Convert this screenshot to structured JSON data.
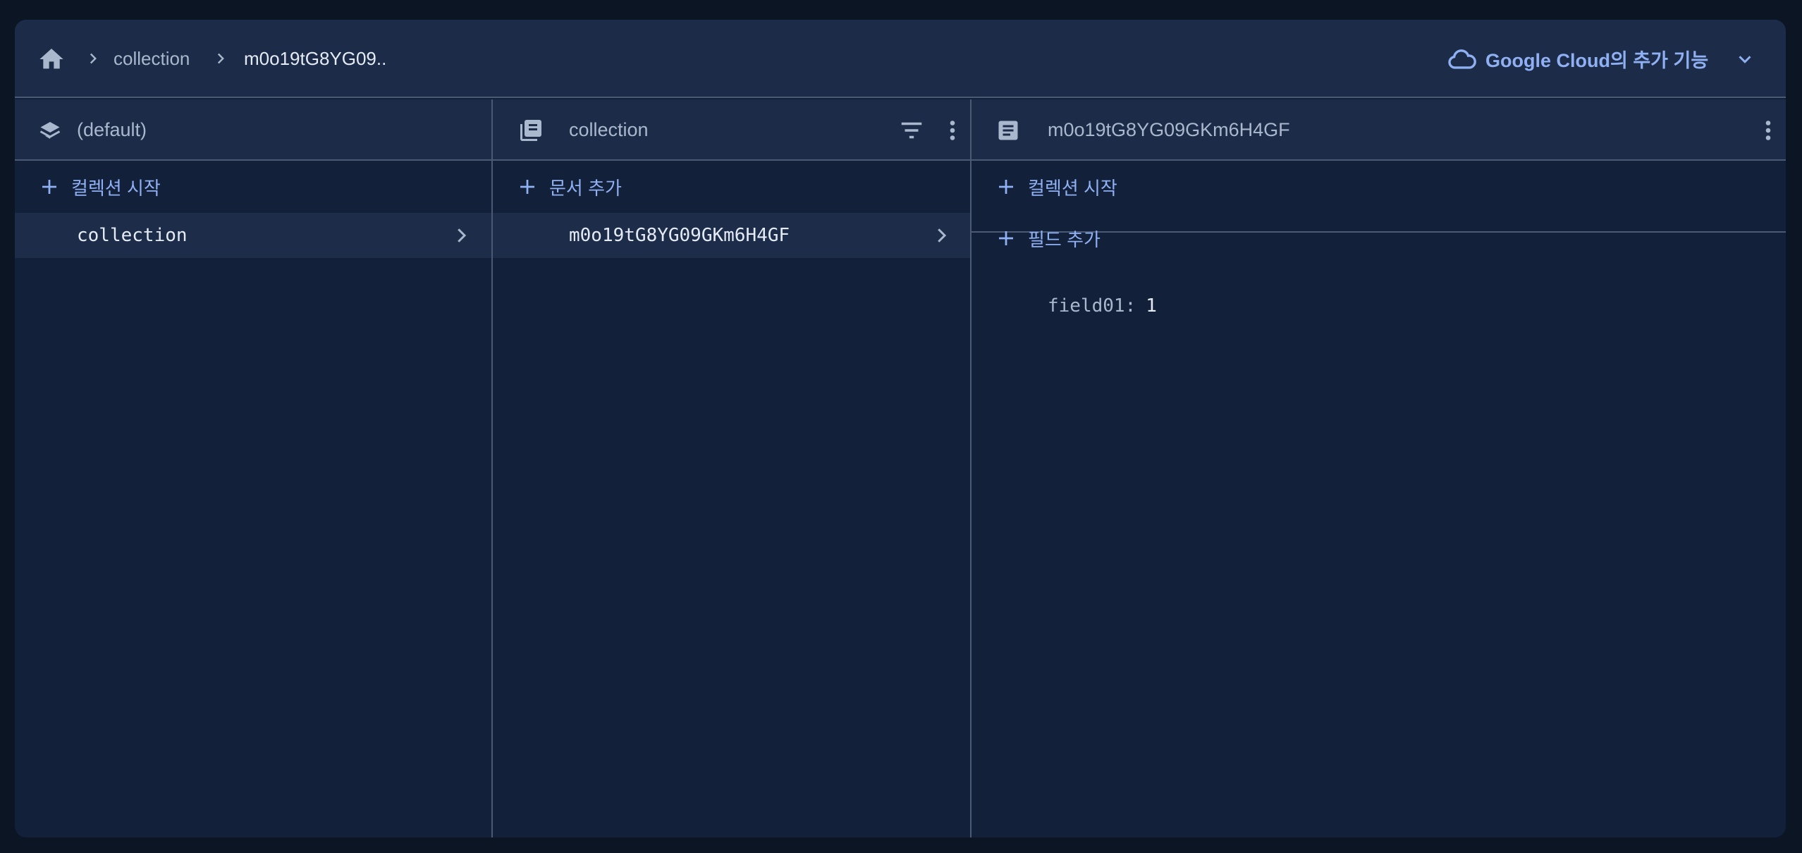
{
  "breadcrumb": {
    "home_icon": "home-icon",
    "items": [
      "collection",
      "m0o19tG8YG09.."
    ]
  },
  "topbar": {
    "cloud_icon": "cloud-icon",
    "extensions_label": "Google Cloud의 추가 기능"
  },
  "columns": {
    "database": {
      "icon": "database-stack-icon",
      "title": "(default)",
      "start_collection_label": "컬렉션 시작",
      "items": [
        {
          "label": "collection"
        }
      ]
    },
    "collection": {
      "icon": "collection-icon",
      "title": "collection",
      "add_document_label": "문서 추가",
      "items": [
        {
          "label": "m0o19tG8YG09GKm6H4GF"
        }
      ]
    },
    "document": {
      "icon": "document-icon",
      "title": "m0o19tG8YG09GKm6H4GF",
      "start_collection_label": "컬렉션 시작",
      "add_field_label": "필드 추가",
      "fields": [
        {
          "name": "field01:",
          "value": "1"
        }
      ]
    }
  },
  "colors": {
    "panel_bg": "#13203a",
    "header_bg": "#1c2b47",
    "accent": "#8fb0f2",
    "divider": "#4a5a74",
    "text_primary": "#e4ebf5",
    "text_secondary": "#aab8cd"
  }
}
